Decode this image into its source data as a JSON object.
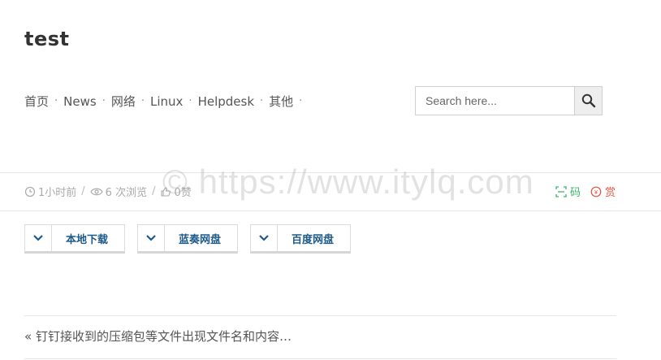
{
  "site": {
    "title": "test"
  },
  "nav": {
    "items": [
      {
        "label": "首页"
      },
      {
        "label": "News"
      },
      {
        "label": "网络"
      },
      {
        "label": "Linux"
      },
      {
        "label": "Helpdesk"
      },
      {
        "label": "其他"
      }
    ],
    "separator": "·"
  },
  "search": {
    "placeholder": "Search here..."
  },
  "meta": {
    "time": "1小时前",
    "views": "6 次浏览",
    "likes": "0赞",
    "separator": "/"
  },
  "actions": {
    "code_label": "码",
    "reward_label": "赏",
    "code_color": "#3bb56a",
    "reward_color": "#e2533f"
  },
  "downloads": [
    {
      "label": "本地下载"
    },
    {
      "label": "蓝奏网盘"
    },
    {
      "label": "百度网盘"
    }
  ],
  "post_nav": {
    "prev_arrow": "«",
    "prev_title": "钉钉接收到的压缩包等文件出现文件名和内容…"
  },
  "watermark": "© https://www.itylq.com",
  "colors": {
    "accent": "#1d5a8a"
  }
}
